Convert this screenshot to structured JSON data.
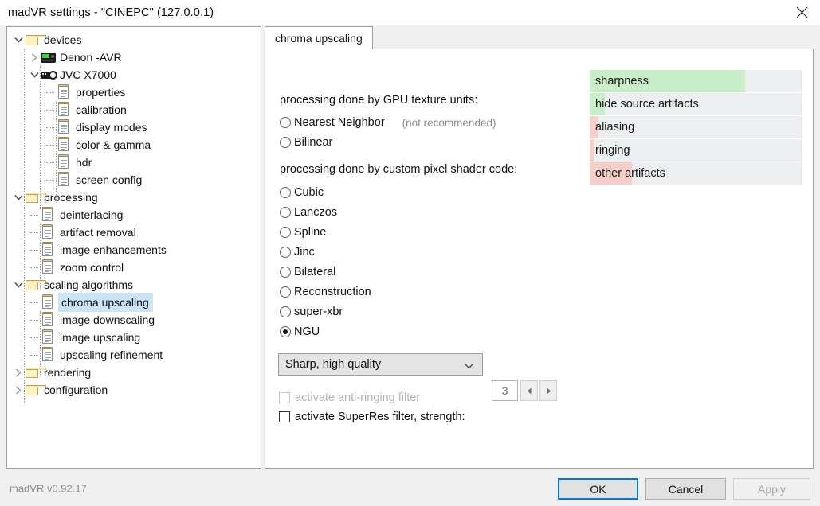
{
  "window": {
    "title": "madVR settings - \"CINEPC\" (127.0.0.1)",
    "close_icon": "close-icon"
  },
  "tree": {
    "nodes": [
      {
        "label": "devices",
        "depth": 0,
        "icon": "folder-icon",
        "expander": "expanded",
        "selected": false
      },
      {
        "label": "Denon -AVR",
        "depth": 1,
        "icon": "avr-icon",
        "expander": "collapsed",
        "selected": false
      },
      {
        "label": "JVC X7000",
        "depth": 1,
        "icon": "projector-icon",
        "expander": "expanded",
        "selected": false
      },
      {
        "label": "properties",
        "depth": 2,
        "icon": "page-icon",
        "expander": "none",
        "selected": false
      },
      {
        "label": "calibration",
        "depth": 2,
        "icon": "page-icon",
        "expander": "none",
        "selected": false
      },
      {
        "label": "display modes",
        "depth": 2,
        "icon": "page-icon",
        "expander": "none",
        "selected": false
      },
      {
        "label": "color & gamma",
        "depth": 2,
        "icon": "page-icon",
        "expander": "none",
        "selected": false
      },
      {
        "label": "hdr",
        "depth": 2,
        "icon": "page-icon",
        "expander": "none",
        "selected": false
      },
      {
        "label": "screen config",
        "depth": 2,
        "icon": "page-icon",
        "expander": "none",
        "selected": false
      },
      {
        "label": "processing",
        "depth": 0,
        "icon": "folder-icon",
        "expander": "expanded",
        "selected": false
      },
      {
        "label": "deinterlacing",
        "depth": 1,
        "icon": "page-icon",
        "expander": "none",
        "selected": false
      },
      {
        "label": "artifact removal",
        "depth": 1,
        "icon": "page-icon",
        "expander": "none",
        "selected": false
      },
      {
        "label": "image enhancements",
        "depth": 1,
        "icon": "page-icon",
        "expander": "none",
        "selected": false
      },
      {
        "label": "zoom control",
        "depth": 1,
        "icon": "page-icon",
        "expander": "none",
        "selected": false
      },
      {
        "label": "scaling algorithms",
        "depth": 0,
        "icon": "folder-icon",
        "expander": "expanded",
        "selected": false
      },
      {
        "label": "chroma upscaling",
        "depth": 1,
        "icon": "page-icon",
        "expander": "none",
        "selected": true
      },
      {
        "label": "image downscaling",
        "depth": 1,
        "icon": "page-icon",
        "expander": "none",
        "selected": false
      },
      {
        "label": "image upscaling",
        "depth": 1,
        "icon": "page-icon",
        "expander": "none",
        "selected": false
      },
      {
        "label": "upscaling refinement",
        "depth": 1,
        "icon": "page-icon",
        "expander": "none",
        "selected": false
      },
      {
        "label": "rendering",
        "depth": 0,
        "icon": "folder-icon",
        "expander": "collapsed",
        "selected": false
      },
      {
        "label": "configuration",
        "depth": 0,
        "icon": "folder-icon",
        "expander": "collapsed",
        "selected": false
      }
    ]
  },
  "tab": {
    "label": "chroma upscaling"
  },
  "main": {
    "gpu_group_label": "processing done by GPU texture units:",
    "gpu_options": [
      {
        "label": "Nearest Neighbor",
        "checked": false,
        "hint": "(not recommended)"
      },
      {
        "label": "Bilinear",
        "checked": false,
        "hint": ""
      }
    ],
    "shader_group_label": "processing done by custom pixel shader code:",
    "shader_options": [
      {
        "label": "Cubic",
        "checked": false
      },
      {
        "label": "Lanczos",
        "checked": false
      },
      {
        "label": "Spline",
        "checked": false
      },
      {
        "label": "Jinc",
        "checked": false
      },
      {
        "label": "Bilateral",
        "checked": false
      },
      {
        "label": "Reconstruction",
        "checked": false
      },
      {
        "label": "super-xbr",
        "checked": false
      },
      {
        "label": "NGU",
        "checked": true
      }
    ],
    "quality_dropdown": {
      "value": "Sharp, high quality",
      "caret_icon": "chevron-down-icon"
    },
    "anti_ringing": {
      "label": "activate anti-ringing filter",
      "checked": false,
      "disabled": true
    },
    "superres": {
      "label": "activate SuperRes filter, strength:",
      "checked": false,
      "disabled": false,
      "strength": "3",
      "prev_icon": "arrow-left-icon",
      "next_icon": "arrow-right-icon"
    }
  },
  "quality_meter": {
    "track_color": "#eceef0",
    "good_color": "#c9efc9",
    "bad_color": "#f5cfc8",
    "rows": [
      {
        "label": "sharpness",
        "fill_percent": 73,
        "fill_kind": "good"
      },
      {
        "label": "hide source artifacts",
        "fill_percent": 7,
        "fill_kind": "good"
      },
      {
        "label": "aliasing",
        "fill_percent": 4,
        "fill_kind": "bad"
      },
      {
        "label": "ringing",
        "fill_percent": 2,
        "fill_kind": "bad"
      },
      {
        "label": "other artifacts",
        "fill_percent": 20,
        "fill_kind": "bad"
      }
    ]
  },
  "footer": {
    "version": "madVR v0.92.17",
    "ok_label": "OK",
    "cancel_label": "Cancel",
    "apply_label": "Apply",
    "apply_disabled": true,
    "focus_color": "#0078d7"
  }
}
